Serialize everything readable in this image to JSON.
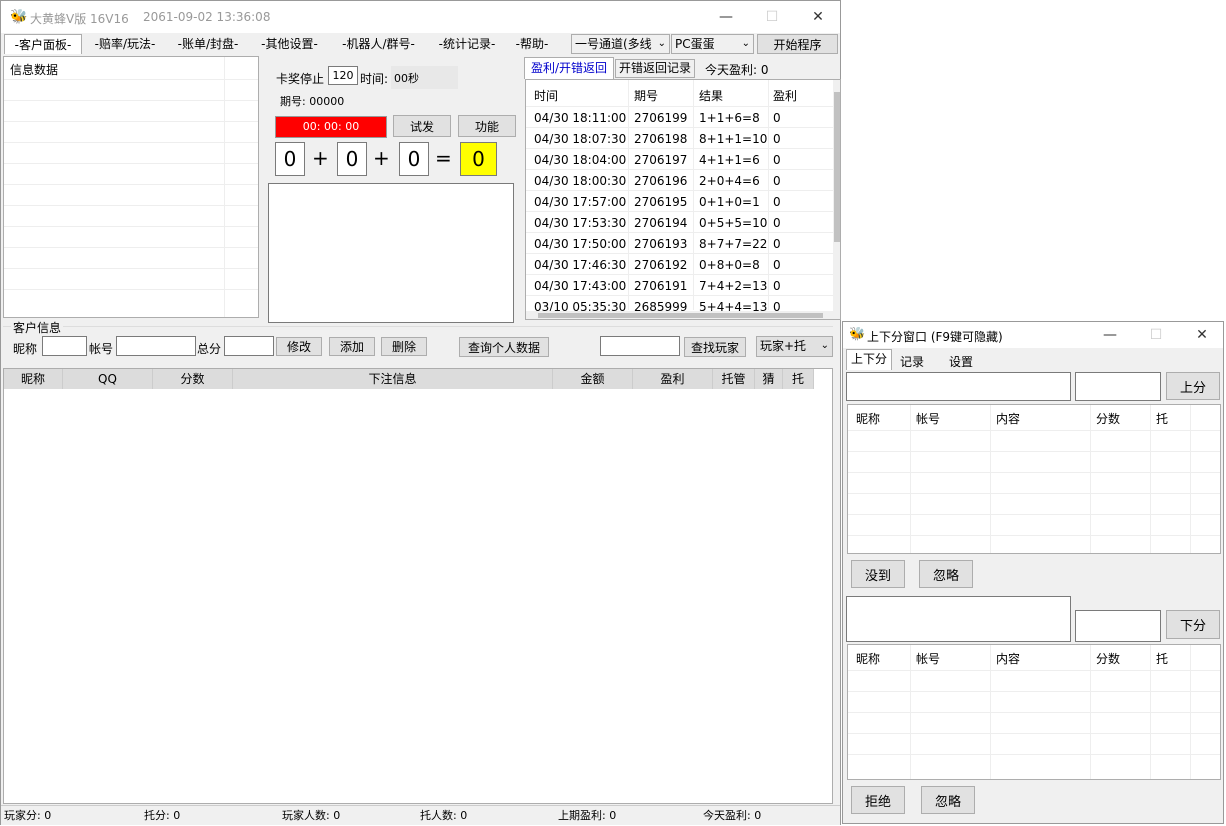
{
  "main": {
    "title": "大黄蜂V版 16V16",
    "datetime": "2061-09-02 13:36:08",
    "menu": [
      "-客户面板-",
      "-赔率/玩法-",
      "-账单/封盘-",
      "-其他设置-",
      "-机器人/群号-",
      "-统计记录-",
      "-帮助-"
    ],
    "channel": "一号通道(多线",
    "game": "PC蛋蛋",
    "start_btn": "开始程序",
    "info_data": "信息数据",
    "stop_label": "卡奖停止",
    "stop_value": "120",
    "time_label": "时间:",
    "time_value": "00秒",
    "period_label": "期号: 00000",
    "timer": "00: 00: 00",
    "trial_btn": "试发",
    "func_btn": "功能",
    "digits": [
      "0",
      "0",
      "0",
      "0"
    ],
    "ops": [
      "+",
      "+",
      "="
    ],
    "tabs": [
      "盈利/开错返回",
      "开错返回记录",
      "今天盈利: 0"
    ],
    "table_headers": [
      "时间",
      "期号",
      "结果",
      "盈利"
    ],
    "rows": [
      [
        "04/30 18:11:00",
        "2706199",
        "1+1+6=8",
        "0"
      ],
      [
        "04/30 18:07:30",
        "2706198",
        "8+1+1=10",
        "0"
      ],
      [
        "04/30 18:04:00",
        "2706197",
        "4+1+1=6",
        "0"
      ],
      [
        "04/30 18:00:30",
        "2706196",
        "2+0+4=6",
        "0"
      ],
      [
        "04/30 17:57:00",
        "2706195",
        "0+1+0=1",
        "0"
      ],
      [
        "04/30 17:53:30",
        "2706194",
        "0+5+5=10",
        "0"
      ],
      [
        "04/30 17:50:00",
        "2706193",
        "8+7+7=22",
        "0"
      ],
      [
        "04/30 17:46:30",
        "2706192",
        "0+8+0=8",
        "0"
      ],
      [
        "04/30 17:43:00",
        "2706191",
        "7+4+2=13",
        "0"
      ],
      [
        "03/10 05:35:30",
        "2685999",
        "5+4+4=13",
        "0"
      ]
    ],
    "cust_group": "客户信息",
    "nick_label": "昵称",
    "acct_label": "帐号",
    "total_label": "总分",
    "modify_btn": "修改",
    "add_btn": "添加",
    "delete_btn": "删除",
    "query_btn": "查询个人数据",
    "find_btn": "查找玩家",
    "filter": "玩家+托",
    "grid_headers": [
      "昵称",
      "QQ",
      "分数",
      "下注信息",
      "金额",
      "盈利",
      "托管",
      "猜",
      "托"
    ],
    "status": [
      "玩家分: 0",
      "托分: 0",
      "玩家人数: 0",
      "托人数: 0",
      "上期盈利: 0",
      "今天盈利: 0"
    ]
  },
  "side": {
    "title": "上下分窗口 (F9键可隐藏)",
    "tabs": [
      "上下分",
      "记录",
      "设置"
    ],
    "up_btn": "上分",
    "down_btn": "下分",
    "headers": [
      "昵称",
      "帐号",
      "内容",
      "分数",
      "托"
    ],
    "ignore1": "没到",
    "ignore2": "忽略",
    "reject": "拒绝",
    "ignore3": "忽略"
  }
}
